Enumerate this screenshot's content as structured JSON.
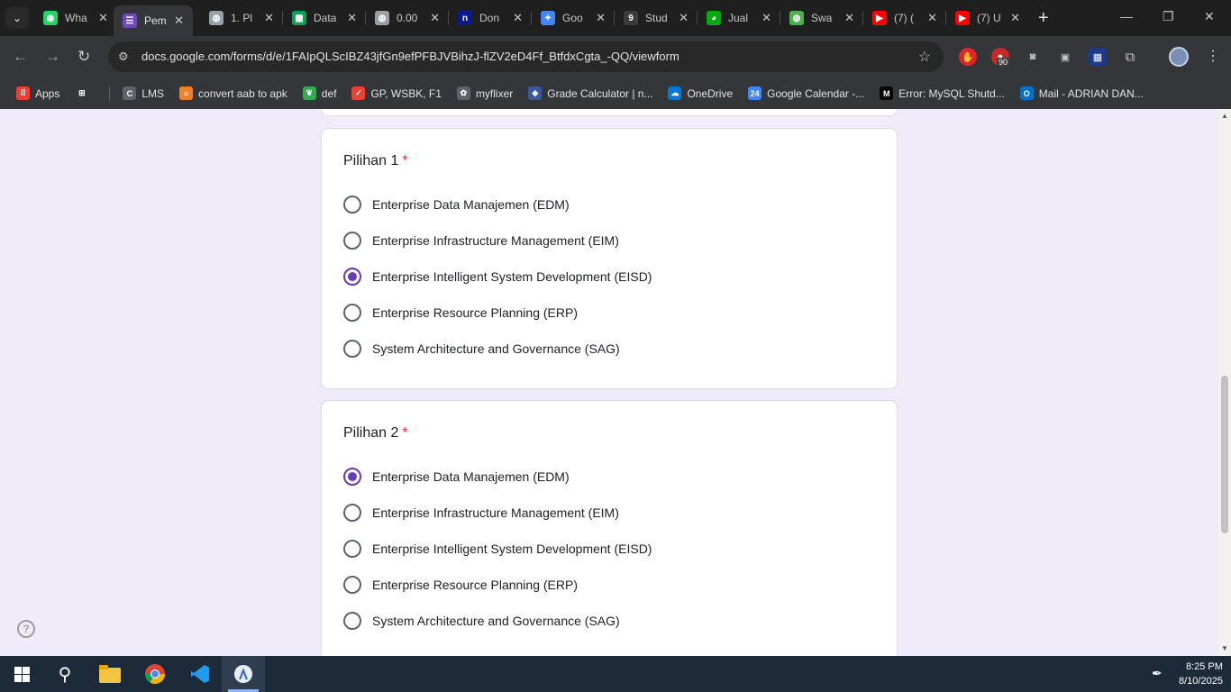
{
  "browser": {
    "tabs": [
      {
        "title": "Wha",
        "icon": "whatsapp-icon",
        "color": "#25d366",
        "glyph": "◉"
      },
      {
        "title": "Pem",
        "icon": "google-forms-icon",
        "color": "#7248b9",
        "glyph": "☰",
        "active": true
      },
      {
        "title": "1. Pl",
        "icon": "globe-icon",
        "color": "#9aa0a6",
        "glyph": "◍"
      },
      {
        "title": "Data",
        "icon": "google-sheets-icon",
        "color": "#0f9d58",
        "glyph": "▦"
      },
      {
        "title": "0.00",
        "icon": "globe-icon",
        "color": "#9aa0a6",
        "glyph": "◍"
      },
      {
        "title": "Don",
        "icon": "n-icon",
        "color": "#0d1b8a",
        "glyph": "n"
      },
      {
        "title": "Goo",
        "icon": "gemini-icon",
        "color": "#4285f4",
        "glyph": "✦"
      },
      {
        "title": "Stud",
        "icon": "studocu-icon",
        "color": "#3a3a3a",
        "glyph": "9"
      },
      {
        "title": "Jual",
        "icon": "tokopedia-icon",
        "color": "#03ac0e",
        "glyph": "◕"
      },
      {
        "title": "Swa",
        "icon": "globe-green-icon",
        "color": "#4caf50",
        "glyph": "◍"
      },
      {
        "title": "(7) (",
        "icon": "youtube-icon",
        "color": "#ff0000",
        "glyph": "▶"
      },
      {
        "title": "(7) U",
        "icon": "youtube-icon",
        "color": "#ff0000",
        "glyph": "▶"
      }
    ],
    "url": "docs.google.com/forms/d/e/1FAIpQLScIBZ43jfGn9efPFBJVBihzJ-flZV2eD4Ff_BtfdxCgta_-QQ/viewform",
    "extension_badge": "90",
    "bookmarks": [
      {
        "label": "Apps",
        "icon": "apps-grid-icon",
        "color": "#ea4335",
        "glyph": "⠿"
      },
      {
        "label": "",
        "icon": "grid-icon",
        "color": "#35363a",
        "glyph": "⊞"
      },
      {
        "label": "LMS",
        "icon": "lms-icon",
        "color": "#5f6368",
        "glyph": "C"
      },
      {
        "label": "convert aab to apk",
        "icon": "stackoverflow-icon",
        "color": "#f48024",
        "glyph": "≡"
      },
      {
        "label": "def",
        "icon": "leaf-icon",
        "color": "#34a853",
        "glyph": "❦"
      },
      {
        "label": "GP, WSBK, F1",
        "icon": "check-icon",
        "color": "#ea4335",
        "glyph": "✓"
      },
      {
        "label": "myflixer",
        "icon": "film-icon",
        "color": "#5f6368",
        "glyph": "✿"
      },
      {
        "label": "Grade Calculator | n...",
        "icon": "shield-icon",
        "color": "#3b5998",
        "glyph": "◈"
      },
      {
        "label": "OneDrive",
        "icon": "onedrive-icon",
        "color": "#0078d4",
        "glyph": "☁"
      },
      {
        "label": "Google Calendar -...",
        "icon": "calendar-icon",
        "color": "#4285f4",
        "glyph": "24"
      },
      {
        "label": "Error: MySQL Shutd...",
        "icon": "medium-icon",
        "color": "#000000",
        "glyph": "M"
      },
      {
        "label": "Mail - ADRIAN DAN...",
        "icon": "outlook-icon",
        "color": "#0072c6",
        "glyph": "O"
      }
    ]
  },
  "form": {
    "questions": [
      {
        "title": "Pilihan 1",
        "required_mark": "*",
        "selected": 2,
        "options": [
          "Enterprise Data Manajemen (EDM)",
          "Enterprise Infrastructure Management (EIM)",
          "Enterprise Intelligent System Development (EISD)",
          "Enterprise Resource Planning (ERP)",
          "System Architecture and Governance (SAG)"
        ]
      },
      {
        "title": "Pilihan 2",
        "required_mark": "*",
        "selected": 0,
        "options": [
          "Enterprise Data Manajemen (EDM)",
          "Enterprise Infrastructure Management (EIM)",
          "Enterprise Intelligent System Development (EISD)",
          "Enterprise Resource Planning (ERP)",
          "System Architecture and Governance (SAG)"
        ]
      }
    ],
    "help_glyph": "?"
  },
  "taskbar": {
    "time": "8:25 PM",
    "date": "8/10/2025"
  }
}
